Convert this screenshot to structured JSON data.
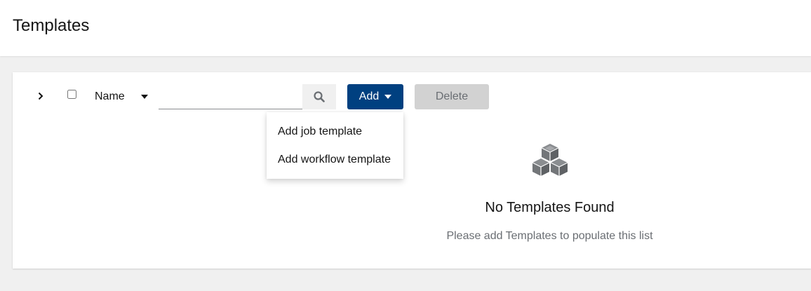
{
  "header": {
    "title": "Templates"
  },
  "toolbar": {
    "filter_label": "Name",
    "search_placeholder": "",
    "add_label": "Add",
    "delete_label": "Delete"
  },
  "add_menu": {
    "items": [
      {
        "label": "Add job template"
      },
      {
        "label": "Add workflow template"
      }
    ]
  },
  "empty_state": {
    "icon": "cubes-icon",
    "title": "No Templates Found",
    "body": "Please add Templates to populate this list"
  },
  "colors": {
    "primary": "#004080",
    "disabled_bg": "#d2d2d2",
    "page_bg": "#f0f0f0",
    "icon_gray": "#737679"
  }
}
